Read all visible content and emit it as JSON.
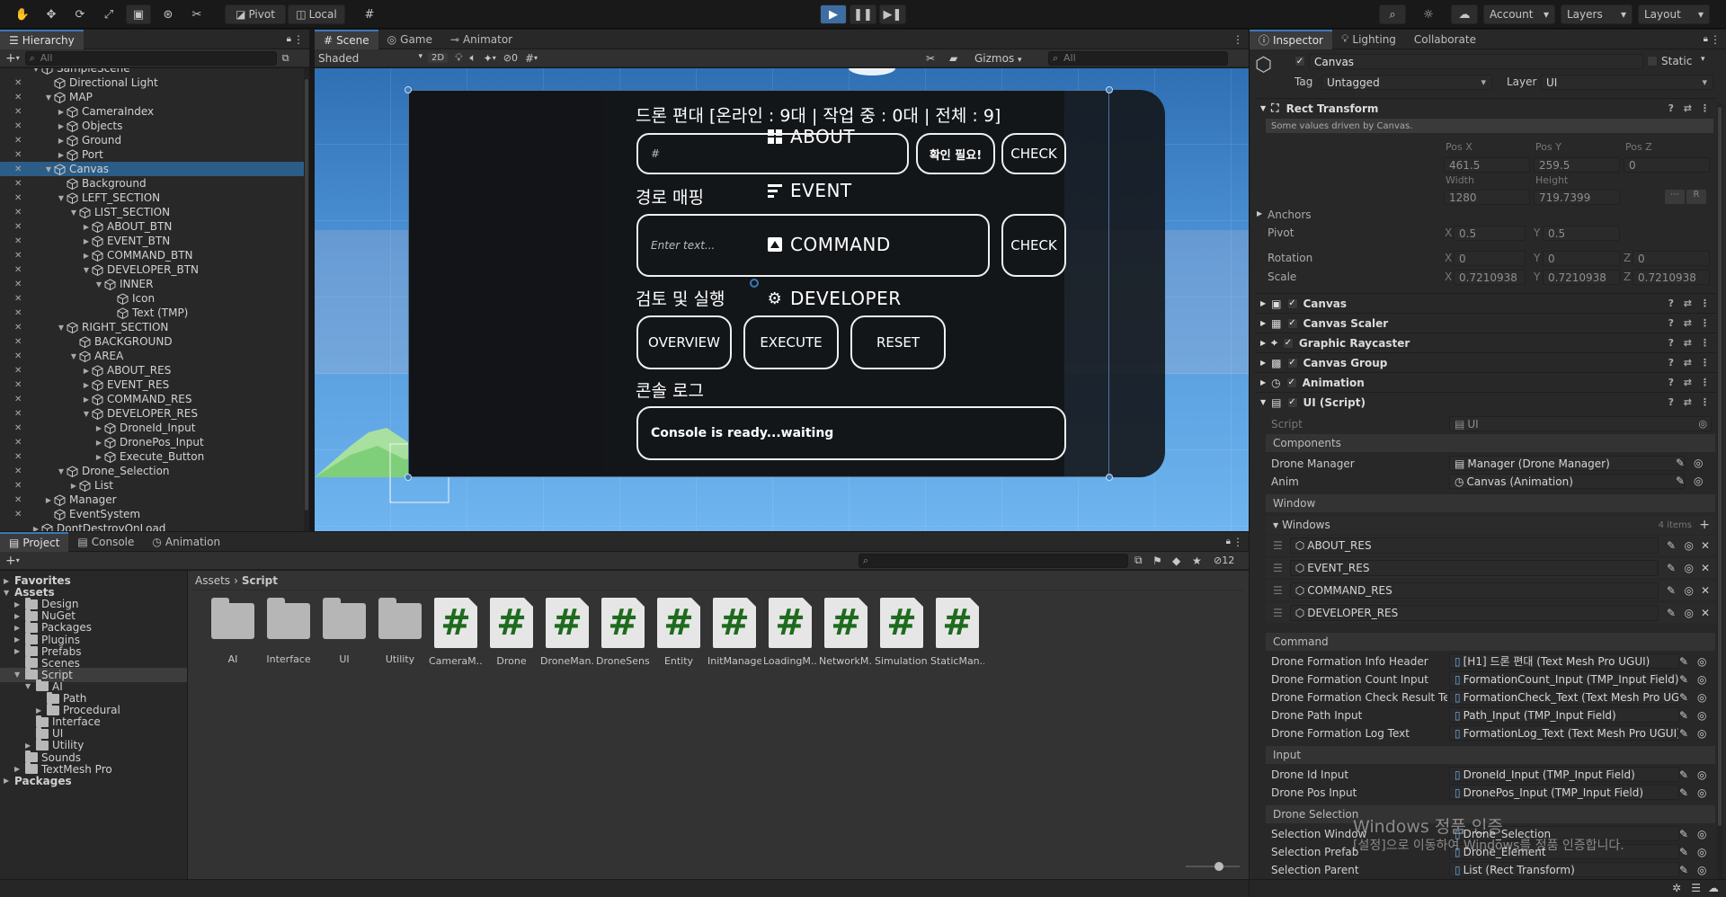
{
  "toolbar": {
    "pivot": "Pivot",
    "local": "Local",
    "account": "Account",
    "layers": "Layers",
    "layout": "Layout"
  },
  "hierarchy": {
    "tab": "Hierarchy",
    "search_placeholder": "All",
    "items": [
      {
        "label": "SampleScene",
        "indent": 0,
        "arrow": "▼"
      },
      {
        "label": "Directional Light",
        "indent": 1,
        "arrow": ""
      },
      {
        "label": "MAP",
        "indent": 1,
        "arrow": "▼"
      },
      {
        "label": "CameraIndex",
        "indent": 2,
        "arrow": "▶"
      },
      {
        "label": "Objects",
        "indent": 2,
        "arrow": "▶"
      },
      {
        "label": "Ground",
        "indent": 2,
        "arrow": "▶"
      },
      {
        "label": "Port",
        "indent": 2,
        "arrow": "▶"
      },
      {
        "label": "Canvas",
        "indent": 1,
        "arrow": "▼",
        "selected": true
      },
      {
        "label": "Background",
        "indent": 2,
        "arrow": ""
      },
      {
        "label": "LEFT_SECTION",
        "indent": 2,
        "arrow": "▼"
      },
      {
        "label": "LIST_SECTION",
        "indent": 3,
        "arrow": "▼"
      },
      {
        "label": "ABOUT_BTN",
        "indent": 4,
        "arrow": "▶"
      },
      {
        "label": "EVENT_BTN",
        "indent": 4,
        "arrow": "▶"
      },
      {
        "label": "COMMAND_BTN",
        "indent": 4,
        "arrow": "▶"
      },
      {
        "label": "DEVELOPER_BTN",
        "indent": 4,
        "arrow": "▼"
      },
      {
        "label": "INNER",
        "indent": 5,
        "arrow": "▼"
      },
      {
        "label": "Icon",
        "indent": 6,
        "arrow": ""
      },
      {
        "label": "Text (TMP)",
        "indent": 6,
        "arrow": ""
      },
      {
        "label": "RIGHT_SECTION",
        "indent": 2,
        "arrow": "▼"
      },
      {
        "label": "BACKGROUND",
        "indent": 3,
        "arrow": ""
      },
      {
        "label": "AREA",
        "indent": 3,
        "arrow": "▼"
      },
      {
        "label": "ABOUT_RES",
        "indent": 4,
        "arrow": "▶"
      },
      {
        "label": "EVENT_RES",
        "indent": 4,
        "arrow": "▶"
      },
      {
        "label": "COMMAND_RES",
        "indent": 4,
        "arrow": "▶"
      },
      {
        "label": "DEVELOPER_RES",
        "indent": 4,
        "arrow": "▼"
      },
      {
        "label": "DroneId_Input",
        "indent": 5,
        "arrow": "▶"
      },
      {
        "label": "DronePos_Input",
        "indent": 5,
        "arrow": "▶"
      },
      {
        "label": "Execute_Button",
        "indent": 5,
        "arrow": "▶"
      },
      {
        "label": "Drone_Selection",
        "indent": 2,
        "arrow": "▼"
      },
      {
        "label": "List",
        "indent": 3,
        "arrow": "▶"
      },
      {
        "label": "Manager",
        "indent": 1,
        "arrow": "▶"
      },
      {
        "label": "EventSystem",
        "indent": 1,
        "arrow": ""
      },
      {
        "label": "DontDestroyOnLoad",
        "indent": 0,
        "arrow": "▶"
      }
    ]
  },
  "scene": {
    "tabs": [
      "Scene",
      "Game",
      "Animator"
    ],
    "shading": "Shaded",
    "mode_2d": "2D",
    "hidden_count": "0",
    "gizmos": "Gizmos",
    "search_placeholder": "All"
  },
  "drone_ui": {
    "menu": [
      "ABOUT",
      "EVENT",
      "COMMAND",
      "DEVELOPER"
    ],
    "header": "드론 편대 [온라인 : 9대 | 작업 중 : 0대 | 전체 : 9]",
    "count_placeholder": "#",
    "confirm_btn": "확인 필요!",
    "check_btn": "CHECK",
    "path_title": "경로 매핑",
    "path_placeholder": "Enter text...",
    "check_btn2": "CHECK",
    "review_title": "검토 및 실행",
    "overview_btn": "OVERVIEW",
    "execute_btn": "EXECUTE",
    "reset_btn": "RESET",
    "console_title": "콘솔 로그",
    "console_text": "Console is ready...waiting"
  },
  "project": {
    "tabs": [
      "Project",
      "Console",
      "Animation"
    ],
    "hidden_count": "12",
    "tree": [
      {
        "label": "Favorites",
        "indent": 0,
        "arrow": "▶",
        "bold": true
      },
      {
        "label": "Assets",
        "indent": 0,
        "arrow": "▼",
        "bold": true
      },
      {
        "label": "Design",
        "indent": 1,
        "arrow": "▶"
      },
      {
        "label": "NuGet",
        "indent": 1,
        "arrow": "▶"
      },
      {
        "label": "Packages",
        "indent": 1,
        "arrow": "▶"
      },
      {
        "label": "Plugins",
        "indent": 1,
        "arrow": "▶"
      },
      {
        "label": "Prefabs",
        "indent": 1,
        "arrow": "▶"
      },
      {
        "label": "Scenes",
        "indent": 1,
        "arrow": ""
      },
      {
        "label": "Script",
        "indent": 1,
        "arrow": "▼",
        "selected": true
      },
      {
        "label": "AI",
        "indent": 2,
        "arrow": "▼"
      },
      {
        "label": "Path",
        "indent": 3,
        "arrow": ""
      },
      {
        "label": "Procedural",
        "indent": 3,
        "arrow": "▶"
      },
      {
        "label": "Interface",
        "indent": 2,
        "arrow": ""
      },
      {
        "label": "UI",
        "indent": 2,
        "arrow": ""
      },
      {
        "label": "Utility",
        "indent": 2,
        "arrow": "▶"
      },
      {
        "label": "Sounds",
        "indent": 1,
        "arrow": ""
      },
      {
        "label": "TextMesh Pro",
        "indent": 1,
        "arrow": "▶"
      },
      {
        "label": "Packages",
        "indent": 0,
        "arrow": "▶",
        "bold": true
      }
    ],
    "breadcrumb": [
      "Assets",
      "Script"
    ],
    "assets": [
      {
        "label": "AI",
        "kind": "folder"
      },
      {
        "label": "Interface",
        "kind": "folder"
      },
      {
        "label": "UI",
        "kind": "folder"
      },
      {
        "label": "Utility",
        "kind": "folder"
      },
      {
        "label": "CameraM...",
        "kind": "script"
      },
      {
        "label": "Drone",
        "kind": "script"
      },
      {
        "label": "DroneMan...",
        "kind": "script"
      },
      {
        "label": "DroneSens...",
        "kind": "script"
      },
      {
        "label": "Entity",
        "kind": "script"
      },
      {
        "label": "InitManager",
        "kind": "script"
      },
      {
        "label": "LoadingM...",
        "kind": "script"
      },
      {
        "label": "NetworkM...",
        "kind": "script"
      },
      {
        "label": "Simulation...",
        "kind": "script"
      },
      {
        "label": "StaticMan...",
        "kind": "script"
      }
    ]
  },
  "inspector": {
    "tabs": [
      "Inspector",
      "Lighting",
      "Collaborate"
    ],
    "object_name": "Canvas",
    "static_label": "Static",
    "tag_label": "Tag",
    "tag_value": "Untagged",
    "layer_label": "Layer",
    "layer_value": "UI",
    "rect_transform": "Rect Transform",
    "driven_note": "Some values driven by Canvas.",
    "pos_x_label": "Pos X",
    "pos_y_label": "Pos Y",
    "pos_z_label": "Pos Z",
    "pos_x": "461.5",
    "pos_y": "259.5",
    "pos_z": "0",
    "width_label": "Width",
    "height_label": "Height",
    "width": "1280",
    "height": "719.7399",
    "anchors_label": "Anchors",
    "pivot_label": "Pivot",
    "pivot_x": "0.5",
    "pivot_y": "0.5",
    "rotation_label": "Rotation",
    "rot_x": "0",
    "rot_y": "0",
    "rot_z": "0",
    "scale_label": "Scale",
    "scale_x": "0.7210938",
    "scale_y": "0.7210938",
    "scale_z": "0.7210938",
    "x": "X",
    "y": "Y",
    "z": "Z",
    "components": [
      "Canvas",
      "Canvas Scaler",
      "Graphic Raycaster",
      "Canvas Group",
      "Animation",
      "UI (Script)"
    ],
    "script_label": "Script",
    "script_value": "UI",
    "sec_components": "Components",
    "drone_manager_label": "Drone Manager",
    "drone_manager_value": "Manager (Drone Manager)",
    "anim_label": "Anim",
    "anim_value": "Canvas (Animation)",
    "sec_window": "Window",
    "windows_label": "Windows",
    "windows_count": "4 items",
    "windows": [
      "ABOUT_RES",
      "EVENT_RES",
      "COMMAND_RES",
      "DEVELOPER_RES"
    ],
    "sec_command": "Command",
    "command_fields": [
      {
        "label": "Drone Formation Info Header",
        "value": "[H1] 드론 편대 (Text Mesh Pro UGUI)"
      },
      {
        "label": "Drone Formation Count Input",
        "value": "FormationCount_Input (TMP_Input Field)"
      },
      {
        "label": "Drone Formation Check Result Tex",
        "value": "FormationCheck_Text (Text Mesh Pro UGUI)"
      },
      {
        "label": "Drone Path Input",
        "value": "Path_Input (TMP_Input Field)"
      },
      {
        "label": "Drone Formation Log Text",
        "value": "FormationLog_Text (Text Mesh Pro UGUI)"
      }
    ],
    "sec_input": "Input",
    "input_fields": [
      {
        "label": "Drone Id Input",
        "value": "DroneId_Input (TMP_Input Field)"
      },
      {
        "label": "Drone Pos Input",
        "value": "DronePos_Input (TMP_Input Field)"
      }
    ],
    "sec_selection": "Drone Selection",
    "selection_fields": [
      {
        "label": "Selection Window",
        "value": "Drone_Selection"
      },
      {
        "label": "Selection Prefab",
        "value": "Drone_Element"
      },
      {
        "label": "Selection Parent",
        "value": "List (Rect Transform)"
      }
    ]
  },
  "watermark": {
    "line1": "Windows 정품 인증",
    "line2": "[설정]으로 이동하여 Windows를 정품 인증합니다."
  },
  "colors": {
    "accent": "#3a79bb",
    "selected": "#2c5d87",
    "sky_top": "#2f6fb3",
    "sky_bottom": "#6fb5ef"
  }
}
